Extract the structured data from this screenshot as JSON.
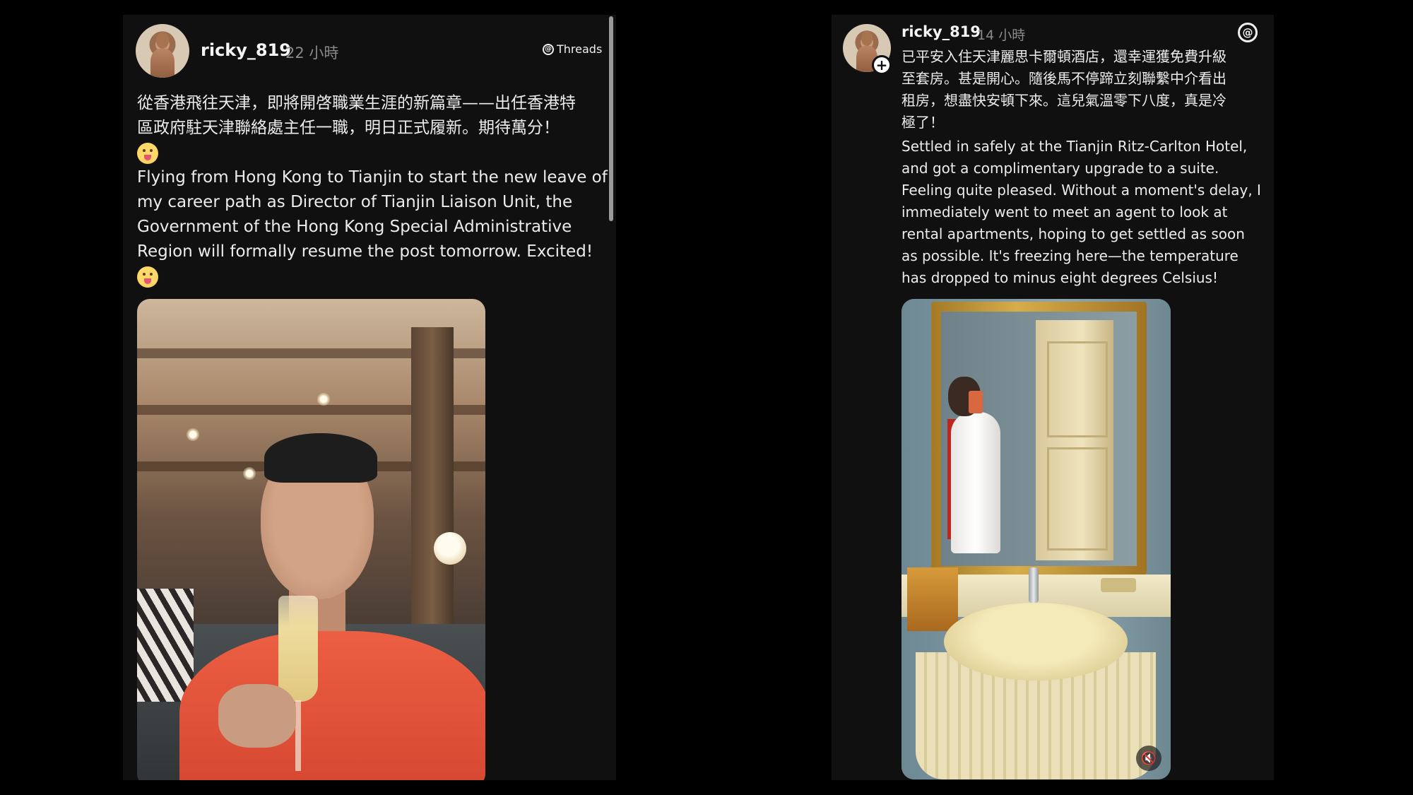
{
  "left_post": {
    "username": "ricky_819",
    "time": "22 小時",
    "source_label": "Threads",
    "text_lines": [
      "從香港飛往天津，即將開啓職業生涯的新篇章——出任香港特",
      "區政府駐天津聯絡處主任一職，明日正式履新。期待萬分！",
      "Flying from Hong Kong to Tianjin to start the new leave of",
      "my career path as Director of Tianjin Liaison Unit, the",
      "Government of the Hong Kong Special Administrative",
      "Region will formally resume the post tomorrow. Excited!"
    ],
    "emoji": "😛"
  },
  "right_post": {
    "username": "ricky_819",
    "time": "14 小時",
    "text_lines": [
      "已平安入住天津麗思卡爾頓酒店，還幸運獲免費升級",
      "至套房。甚是開心。隨後馬不停蹄立刻聯繫中介看出",
      "租房，想盡快安頓下來。這兒氣溫零下八度，真是冷",
      "極了！",
      "Settled in safely at the Tianjin Ritz-Carlton Hotel,",
      "and got a complimentary upgrade to a suite.",
      "Feeling quite pleased. Without a moment's delay, I",
      "immediately went to meet an agent to look at",
      "rental apartments, hoping to get settled as soon",
      "as possible. It's freezing here—the temperature",
      "has dropped to minus eight degrees Celsius!"
    ],
    "follow_icon": "+",
    "mute_icon": "muted-speaker-icon"
  },
  "icons": {
    "threads_mark": "@",
    "mute_glyph": "🔇"
  }
}
